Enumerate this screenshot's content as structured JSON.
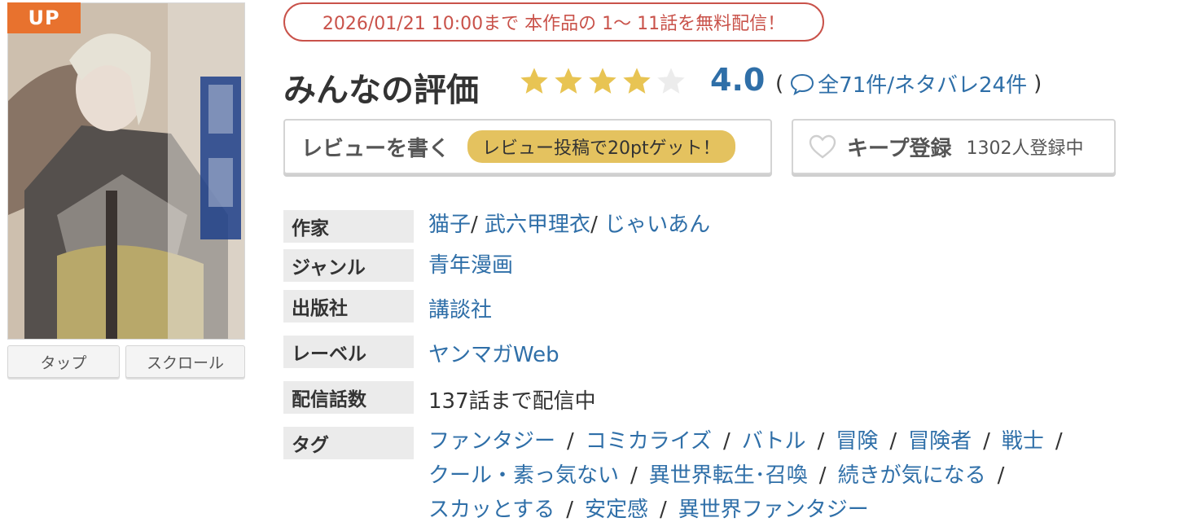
{
  "cover": {
    "badge": "UP",
    "viewer_buttons": [
      "タップ",
      "スクロール"
    ]
  },
  "free_notice": "2026/01/21 10:00まで 本作品の 1〜 11話を無料配信！",
  "rating": {
    "title": "みんなの評価",
    "score": "4.0",
    "stars_filled": 4,
    "stars_total": 5,
    "star_color": "#e8c453",
    "count_open": "(",
    "count_link": "全71件/ネタバレ24件",
    "count_close": ")"
  },
  "review_button": {
    "label": "レビューを書く",
    "pill": "レビュー投稿で20ptゲット！"
  },
  "keep_button": {
    "label": "キープ登録",
    "count": "1302人登録中"
  },
  "info": {
    "author": {
      "label": "作家",
      "values": [
        "猫子",
        "武六甲理衣",
        "じゃいあん"
      ]
    },
    "genre": {
      "label": "ジャンル",
      "value": "青年漫画"
    },
    "publisher": {
      "label": "出版社",
      "value": "講談社"
    },
    "label_row": {
      "label": "レーベル",
      "value": "ヤンマガWeb"
    },
    "episodes": {
      "label": "配信話数",
      "value": "137話まで配信中"
    },
    "tags": {
      "label": "タグ",
      "values": [
        "ファンタジー",
        "コミカライズ",
        "バトル",
        "冒険",
        "冒険者",
        "戦士",
        "クール・素っ気ない",
        "異世界転生･召喚",
        "続きが気になる",
        "スカッとする",
        "安定感",
        "異世界ファンタジー"
      ]
    }
  },
  "colors": {
    "accent_link": "#2f6fa8",
    "badge_orange": "#e8722e",
    "notice_red": "#c9524a",
    "pill_yellow": "#e4c25f"
  }
}
